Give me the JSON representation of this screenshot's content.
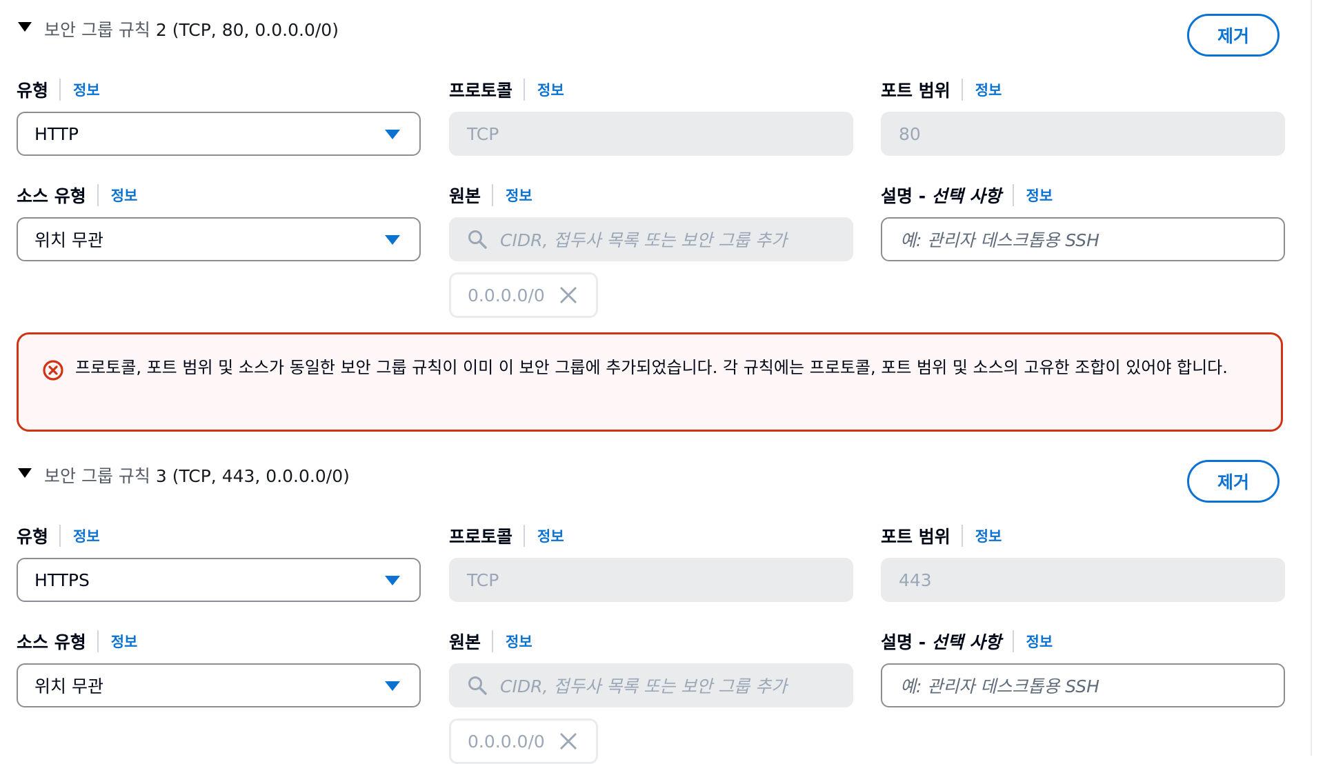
{
  "common": {
    "info_label": "정보",
    "remove_label": "제거",
    "search_placeholder": "CIDR, 접두사 목록 또는 보안 그룹 추가",
    "description_placeholder": "예: 관리자 데스크톱용 SSH"
  },
  "labels": {
    "type": "유형",
    "protocol": "프로토콜",
    "port_range": "포트 범위",
    "source_type": "소스 유형",
    "source": "원본",
    "description_prefix": "설명 - ",
    "description_optional": "선택 사항"
  },
  "rules": [
    {
      "title_prefix": "보안 그룹 규칙",
      "title_rest": " 2 (TCP, 80, 0.0.0.0/0)",
      "type": "HTTP",
      "protocol": "TCP",
      "port_range": "80",
      "source_type": "위치 무관",
      "source_token": "0.0.0.0/0"
    },
    {
      "title_prefix": "보안 그룹 규칙",
      "title_rest": " 3 (TCP, 443, 0.0.0.0/0)",
      "type": "HTTPS",
      "protocol": "TCP",
      "port_range": "443",
      "source_type": "위치 무관",
      "source_token": "0.0.0.0/0"
    }
  ],
  "error": {
    "message": "프로토콜, 포트 범위 및 소스가 동일한 보안 그룹 규칙이 이미 이 보안 그룹에 추가되었습니다. 각 규칙에는 프로토콜, 포트 범위 및 소스의 고유한 조합이 있어야 합니다."
  },
  "icons": {
    "collapse": "caret-down-icon",
    "dropdown": "dropdown-arrow-icon",
    "search": "search-icon",
    "remove_token": "close-icon",
    "error": "error-circle-icon"
  },
  "colors": {
    "accent": "#0972d3",
    "error": "#d13212",
    "disabled_bg": "#e9ebed"
  }
}
